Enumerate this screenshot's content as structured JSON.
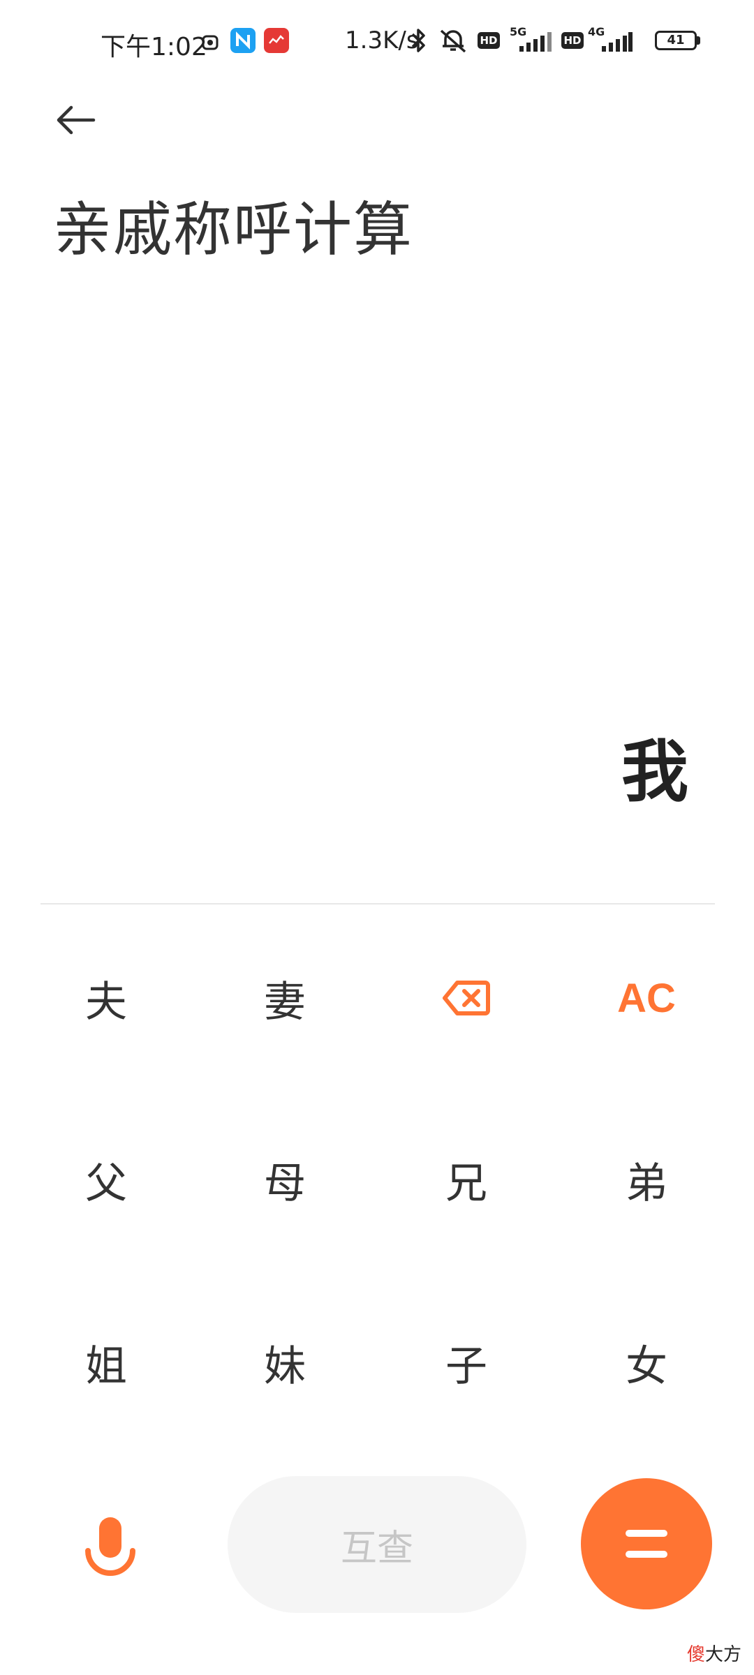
{
  "status_bar": {
    "time": "下午1:02",
    "net_speed": "1.3K/s",
    "net_5g": "5G",
    "net_4g": "4G",
    "hd": "HD",
    "battery_level": "41",
    "colors": {
      "text": "#222222"
    }
  },
  "header": {
    "back_icon": "back-arrow-icon",
    "title": "亲戚称呼计算"
  },
  "display": {
    "result": "我"
  },
  "keypad": {
    "row1": [
      "夫",
      "妻"
    ],
    "ac_label": "AC",
    "row2": [
      "父",
      "母",
      "兄",
      "弟"
    ],
    "row3": [
      "姐",
      "妹",
      "子",
      "女"
    ],
    "mutual_label": "互查",
    "backspace_icon": "backspace-icon",
    "mic_icon": "microphone-icon",
    "equals_icon": "equals-icon"
  },
  "watermark": {
    "accent": "傻",
    "rest": "大方"
  },
  "colors": {
    "accent": "#ff7433",
    "text": "#333333",
    "button_bg": "#f5f5f5",
    "disabled_text": "#c6c6c6"
  }
}
